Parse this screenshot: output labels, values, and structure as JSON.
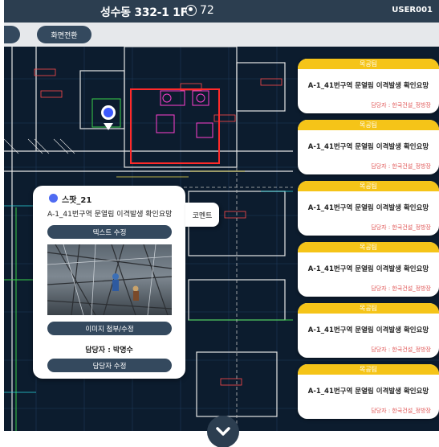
{
  "header": {
    "title": "성수동 332-1 1F",
    "user_count": "72",
    "user_id": "USER001"
  },
  "toolbar": {
    "screen_switch_label": "화면전환"
  },
  "spot_popup": {
    "spot_name": "스팟_21",
    "description": "A-1_41번구역 문열림 이격발생 확인요망",
    "text_edit_label": "텍스트 수정",
    "image_attach_label": "이미지 첨부/수정",
    "owner_text": "담당자 : 박명수",
    "owner_edit_label": "담당자 수정",
    "comment_label": "코멘트"
  },
  "issue_cards": [
    {
      "team": "목공팀",
      "title": "A-1_41번구역 문열림 이격발생 확인요망",
      "owner": "담당자 : 한국건설_정방장"
    },
    {
      "team": "목공팀",
      "title": "A-1_41번구역 문열림 이격발생 확인요망",
      "owner": "담당자 : 한국건설_정방장"
    },
    {
      "team": "목공팀",
      "title": "A-1_41번구역 문열림 이격발생 확인요망",
      "owner": "담당자 : 한국건설_정방장"
    },
    {
      "team": "목공팀",
      "title": "A-1_41번구역 문열림 이격발생 확인요망",
      "owner": "담당자 : 한국건설_정방장"
    },
    {
      "team": "목공팀",
      "title": "A-1_41번구역 문열림 이격발생 확인요망",
      "owner": "담당자 : 한국건설_정방장"
    },
    {
      "team": "목공팀",
      "title": "A-1_41번구역 문열림 이격발생 확인요망",
      "owner": "담당자 : 한국건설_정방장"
    }
  ],
  "icons": {
    "users": "user-icon",
    "scroll_down": "chevron-down-icon"
  },
  "colors": {
    "header_bg": "#2c3e50",
    "card_header": "#f5c418",
    "marker": "#3d5afe",
    "highlight_box": "#ff2a2a"
  }
}
